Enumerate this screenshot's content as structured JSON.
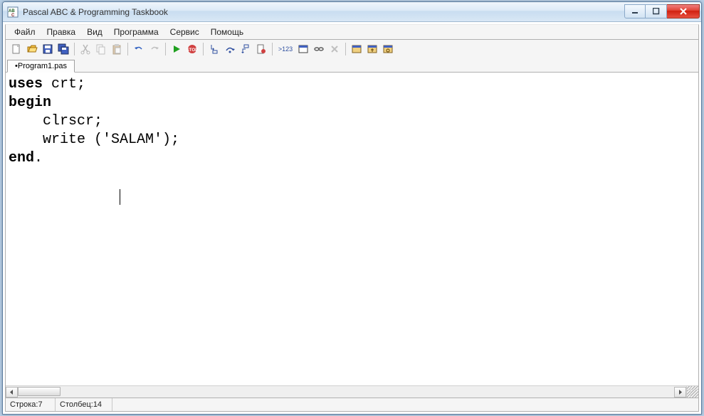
{
  "title": "Pascal ABC & Programming Taskbook",
  "menu": {
    "file": "Файл",
    "edit": "Правка",
    "view": "Вид",
    "program": "Программа",
    "service": "Сервис",
    "help": "Помощь"
  },
  "tabs": {
    "program1": "•Program1.pas"
  },
  "code": {
    "kw_uses": "uses",
    "uses_rest": " crt;",
    "kw_begin": "begin",
    "line3": "    clrscr;",
    "line4_a": "    write (",
    "line4_str": "'SALAM'",
    "line4_b": ");",
    "kw_end": "end",
    "end_rest": ".",
    "line7_indent": "             "
  },
  "status": {
    "line_label": "Строка: ",
    "line_value": "7",
    "col_label": "Столбец: ",
    "col_value": "14"
  },
  "toolbar_label_123": ">123"
}
